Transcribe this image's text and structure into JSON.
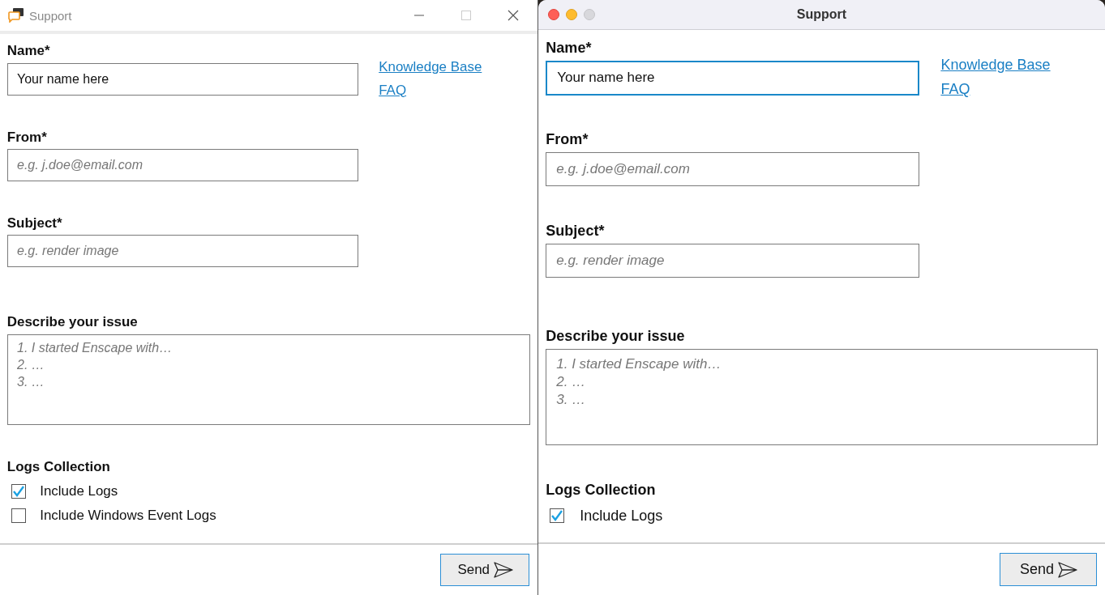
{
  "windows": [
    {
      "kind": "windows",
      "title": "Support",
      "fields": [
        {
          "label": "Name*",
          "value": "Your name here",
          "focused": false
        },
        {
          "label": "From*",
          "placeholder": "e.g. j.doe@email.com",
          "focused": false
        },
        {
          "label": "Subject*",
          "placeholder": "e.g. render image",
          "focused": false
        }
      ],
      "links": [
        "Knowledge Base",
        "FAQ"
      ],
      "issue": {
        "label": "Describe your issue",
        "placeholder": "1. I started Enscape with…\n2. …\n3. …"
      },
      "logs": {
        "title": "Logs Collection",
        "options": [
          {
            "label": "Include Logs",
            "checked": true
          },
          {
            "label": "Include Windows Event Logs",
            "checked": false
          }
        ]
      },
      "send_button": "Send"
    },
    {
      "kind": "mac",
      "title": "Support",
      "fields": [
        {
          "label": "Name*",
          "value": "Your name here",
          "focused": true
        },
        {
          "label": "From*",
          "placeholder": "e.g. j.doe@email.com",
          "focused": false
        },
        {
          "label": "Subject*",
          "placeholder": "e.g. render image",
          "focused": false
        }
      ],
      "links": [
        "Knowledge Base",
        "FAQ"
      ],
      "issue": {
        "label": "Describe your issue",
        "placeholder": "1. I started Enscape with…\n2. …\n3. …"
      },
      "logs": {
        "title": "Logs Collection",
        "options": [
          {
            "label": "Include Logs",
            "checked": true
          }
        ]
      },
      "send_button": "Send"
    }
  ]
}
